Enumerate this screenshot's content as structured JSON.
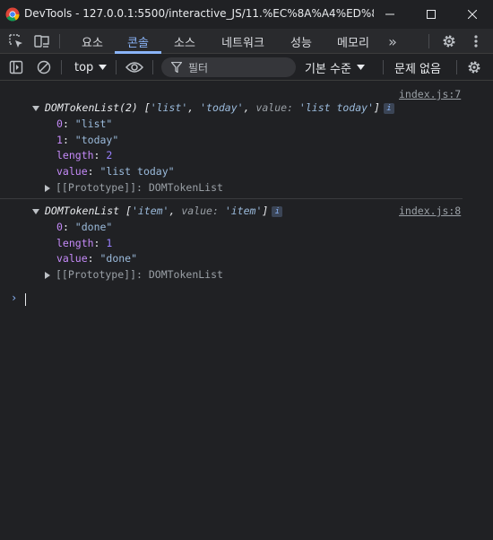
{
  "window": {
    "title": "DevTools - 127.0.0.1:5500/interactive_JS/11.%EC%8A%A4%ED%83%8...",
    "minimize": "—",
    "maximize": "☐",
    "close": "✕"
  },
  "tabs": {
    "items": [
      {
        "label": "요소"
      },
      {
        "label": "콘솔",
        "active": true
      },
      {
        "label": "소스"
      },
      {
        "label": "네트워크"
      },
      {
        "label": "성능"
      },
      {
        "label": "메모리"
      }
    ],
    "more": "»"
  },
  "console_toolbar": {
    "context": "top",
    "filter_placeholder": "필터",
    "levels": "기본 수준",
    "issues": "문제 없음"
  },
  "messages": [
    {
      "source": "index.js:7",
      "summary_prefix": "DOMTokenList(2) [",
      "summary_items": [
        "'list'",
        "'today'"
      ],
      "summary_value_key": "value:",
      "summary_value": "'list today'",
      "summary_suffix": "]",
      "props": [
        {
          "key": "0",
          "sep": ": ",
          "value": "\"list\""
        },
        {
          "key": "1",
          "sep": ": ",
          "value": "\"today\""
        },
        {
          "key": "length",
          "sep": ": ",
          "value": "2"
        },
        {
          "key": "value",
          "sep": ": ",
          "value": "\"list today\""
        }
      ],
      "proto": "[[Prototype]]: DOMTokenList"
    },
    {
      "source": "index.js:8",
      "summary_prefix": "DOMTokenList [",
      "summary_items": [
        "'item'"
      ],
      "summary_value_key": "value:",
      "summary_value": "'item'",
      "summary_suffix": "]",
      "props": [
        {
          "key": "0",
          "sep": ": ",
          "value": "\"done\""
        },
        {
          "key": "length",
          "sep": ": ",
          "value": "1"
        },
        {
          "key": "value",
          "sep": ": ",
          "value": "\"done\""
        }
      ],
      "proto": "[[Prototype]]: DOMTokenList"
    }
  ],
  "prompt_symbol": "›",
  "colors": {
    "background": "#202124",
    "toolbar": "#292a2d",
    "accent": "#8ab4f8",
    "string": "#9bbbdc",
    "number": "#9980ff"
  }
}
